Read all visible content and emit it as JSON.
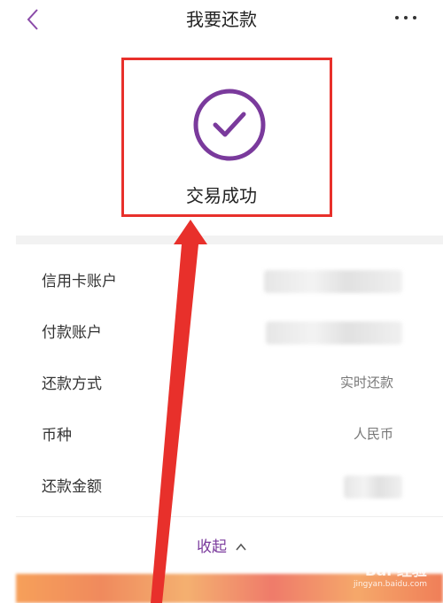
{
  "header": {
    "title": "我要还款",
    "back_icon": "chevron-left-icon",
    "more_icon": "more-horizontal-icon"
  },
  "result": {
    "status_text": "交易成功",
    "icon": "check-circle-icon"
  },
  "details": [
    {
      "label": "信用卡账户",
      "value": ""
    },
    {
      "label": "付款账户",
      "value": ""
    },
    {
      "label": "还款方式",
      "value": "实时还款"
    },
    {
      "label": "币种",
      "value": "人民币"
    },
    {
      "label": "还款金额",
      "value": ""
    }
  ],
  "collapse": {
    "label": "收起",
    "icon": "chevron-up-icon"
  },
  "watermark": {
    "main": "Bai 经验",
    "sub": "jingyan.baidu.com"
  },
  "colors": {
    "accent_purple": "#7a3a9c",
    "highlight_red": "#e8302b"
  }
}
